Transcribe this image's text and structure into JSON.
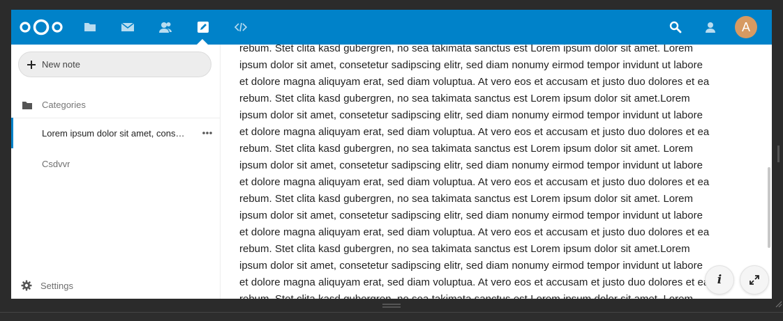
{
  "header": {
    "brand_color": "#0082c9",
    "nav": [
      {
        "icon": "files-icon"
      },
      {
        "icon": "mail-icon"
      },
      {
        "icon": "contacts-icon"
      },
      {
        "icon": "notes-icon",
        "active": true
      },
      {
        "icon": "code-icon"
      }
    ],
    "avatar_initial": "A"
  },
  "sidebar": {
    "new_note_label": "New note",
    "categories_label": "Categories",
    "notes": [
      {
        "title": "Lorem ipsum dolor sit amet, consetetur sadipscing elitr",
        "active": true
      },
      {
        "title": "Csdvvr",
        "active": false
      }
    ],
    "settings_label": "Settings"
  },
  "editor": {
    "lines": [
      "rebum. Stet clita kasd gubergren, no sea takimata sanctus est Lorem ipsum dolor sit amet. Lorem",
      "ipsum dolor sit amet, consetetur sadipscing elitr, sed diam nonumy eirmod tempor invidunt ut labore",
      "et dolore magna aliquyam erat, sed diam voluptua. At vero eos et accusam et justo duo dolores et ea",
      "rebum. Stet clita kasd gubergren, no sea takimata sanctus est Lorem ipsum dolor sit amet.Lorem",
      "ipsum dolor sit amet, consetetur sadipscing elitr, sed diam nonumy eirmod tempor invidunt ut labore",
      "et dolore magna aliquyam erat, sed diam voluptua. At vero eos et accusam et justo duo dolores et ea",
      "rebum. Stet clita kasd gubergren, no sea takimata sanctus est Lorem ipsum dolor sit amet. Lorem",
      "ipsum dolor sit amet, consetetur sadipscing elitr, sed diam nonumy eirmod tempor invidunt ut labore",
      "et dolore magna aliquyam erat, sed diam voluptua. At vero eos et accusam et justo duo dolores et ea",
      "rebum. Stet clita kasd gubergren, no sea takimata sanctus est Lorem ipsum dolor sit amet. Lorem",
      "ipsum dolor sit amet, consetetur sadipscing elitr, sed diam nonumy eirmod tempor invidunt ut labore",
      "et dolore magna aliquyam erat, sed diam voluptua. At vero eos et accusam et justo duo dolores et ea",
      "rebum. Stet clita kasd gubergren, no sea takimata sanctus est Lorem ipsum dolor sit amet.Lorem",
      "ipsum dolor sit amet, consetetur sadipscing elitr, sed diam nonumy eirmod tempor invidunt ut labore",
      "et dolore magna aliquyam erat, sed diam voluptua. At vero eos et accusam et justo duo dolores et ea",
      "rebum. Stet clita kasd gubergren, no sea takimata sanctus est Lorem ipsum dolor sit amet. Lorem"
    ]
  },
  "actions": {
    "info_icon": "info-icon",
    "fullscreen_icon": "fullscreen-icon",
    "info_glyph": "i"
  }
}
